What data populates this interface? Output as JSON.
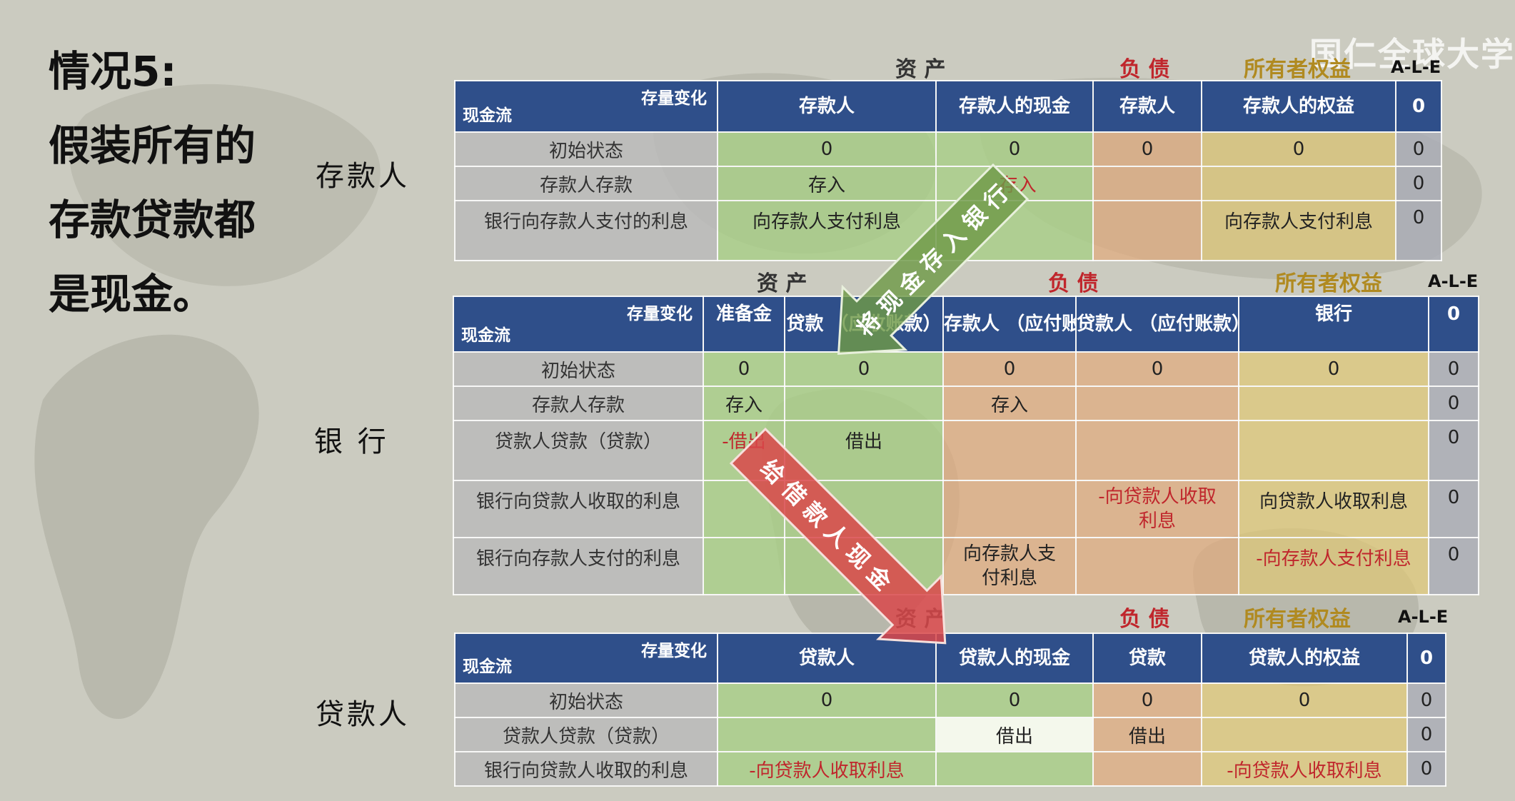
{
  "watermark": "国仁全球大学",
  "title_lines": [
    "情况5:",
    "假装所有的",
    "存款贷款都",
    "是现金。"
  ],
  "parties": {
    "depositor": "存款人",
    "bank": "银 行",
    "borrower": "贷款人"
  },
  "common": {
    "diag_top": "存量变化",
    "diag_bottom": "现金流",
    "ale": "A-L-E",
    "zero": "0"
  },
  "depositor": {
    "groups": {
      "assets": "资 产",
      "liabilities": "负 债",
      "equity": "所有者权益"
    },
    "headers": [
      "存款人",
      "存款人的现金",
      "存款人",
      "存款人的权益",
      "0"
    ],
    "rows": [
      {
        "label": "初始状态",
        "cells": [
          "0",
          "0",
          "0",
          "0",
          "0"
        ]
      },
      {
        "label": "存款人存款",
        "cells": [
          "存入",
          "-存入",
          "",
          "",
          "0"
        ]
      },
      {
        "label": "银行向存款人支付的利息",
        "cells": [
          "向存款人支付利息",
          "",
          "",
          "向存款人支付利息",
          "0"
        ]
      }
    ]
  },
  "bank": {
    "groups": {
      "assets": "资 产",
      "liabilities": "负 债",
      "equity": "所有者权益"
    },
    "headers": [
      "准备金",
      "贷款（应收账款）",
      "存款人（应付账款）",
      "贷款人（应付账款）",
      "银行",
      "0"
    ],
    "header_lines": {
      "loan_line1": "贷款",
      "loan_line2": "（应收账款）",
      "dep_line1": "存款人",
      "dep_line2": "（应付账款）",
      "bor_line1": "贷款人",
      "bor_line2": "（应付账款）"
    },
    "rows": [
      {
        "label": "初始状态",
        "cells": [
          "0",
          "0",
          "0",
          "0",
          "0",
          "0"
        ]
      },
      {
        "label": "存款人存款",
        "cells": [
          "存入",
          "",
          "存入",
          "",
          "",
          "0"
        ]
      },
      {
        "label": "贷款人贷款（贷款）",
        "cells": [
          "-借出",
          "借出",
          "",
          "",
          "",
          "0"
        ]
      },
      {
        "label": "银行向贷款人收取的利息",
        "cells": [
          "",
          "",
          "",
          "-向贷款人收取利息",
          "向贷款人收取利息",
          "0"
        ]
      },
      {
        "label": "银行向存款人支付的利息",
        "cells": [
          "",
          "",
          "向存款人支付利息",
          "",
          "-向存款人支付利息",
          "0"
        ]
      }
    ]
  },
  "borrower": {
    "groups": {
      "assets": "资 产",
      "liabilities": "负 债",
      "equity": "所有者权益"
    },
    "headers": [
      "贷款人",
      "贷款人的现金",
      "贷款",
      "贷款人的权益",
      "0"
    ],
    "rows": [
      {
        "label": "初始状态",
        "cells": [
          "0",
          "0",
          "0",
          "0",
          "0"
        ]
      },
      {
        "label": "贷款人贷款（贷款）",
        "cells": [
          "",
          "借出",
          "借出",
          "",
          "0"
        ]
      },
      {
        "label": "银行向贷款人收取的利息",
        "cells": [
          "-向贷款人收取利息",
          "",
          "",
          "-向贷款人收取利息",
          "0"
        ]
      }
    ]
  },
  "arrows": {
    "deposit": "将现金存入银行",
    "loan": "给借款人现金"
  },
  "colors": {
    "header": "#2f4f8a",
    "asset": "#a8ce86",
    "liability": "#e0aa7d",
    "equity": "#dfc876",
    "negative_text": "#c0262c",
    "deposit_arrow": "#6f9a48",
    "loan_arrow": "#d9484a"
  }
}
